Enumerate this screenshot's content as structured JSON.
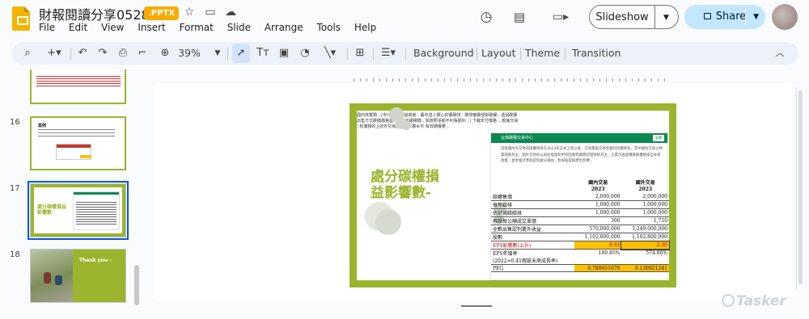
{
  "doc": {
    "title": "財報閱讀分享0528",
    "format_badge": ".PPTX"
  },
  "menu": [
    "File",
    "Edit",
    "View",
    "Insert",
    "Format",
    "Slide",
    "Arrange",
    "Tools",
    "Help"
  ],
  "header": {
    "slideshow_label": "Slideshow",
    "share_label": "Share"
  },
  "toolbar": {
    "zoom": "39%",
    "background": "Background",
    "layout": "Layout",
    "theme": "Theme",
    "transition": "Transition"
  },
  "thumbnails": [
    {
      "num": "",
      "title": ""
    },
    {
      "num": "16",
      "title": "案例"
    },
    {
      "num": "17",
      "title": "處分碳權損益影響數"
    },
    {
      "num": "18",
      "title": "Thank you~"
    }
  ],
  "slide": {
    "intro": "國內林業類...(市(市值市場過高新 ; 臺中送人類心的關碳排 ; 碳排實碳發對碳權 ; 透過碳權出售方式碳價價格基準 ; 碳出碳碳價 ; 與按照淨額不利賬額外...) 下載年付價格 ...根據交易 ; 有價額的上的外交易影部對影響水平 有效碳權量 。",
    "title": "處分碳權損\n益影響數-",
    "panel_header": "台灣碳權交易中心",
    "panel_tag": "新聞",
    "panel_text": "首批國內外交易的碳權項目在2023年正式上架以後，交易量與交易金額均持續增長，其中國內交易以林業碳匯為主，國外交易則以再生能源及甲烷回收等國際認證項目為主，企業可透過購買碳權抵換自身排放量，並依會計準則認列處分損益，對每股盈餘產生影響。",
    "table": {
      "headers": [
        "",
        "國內交易",
        "國外交易"
      ],
      "years": [
        "",
        "2023",
        "2023"
      ],
      "rows": [
        {
          "label": "碳權售價",
          "a": "2,000,000",
          "b": "2,000,000"
        },
        {
          "label": "每年碳排",
          "a": "1,000,000",
          "b": "1,000,000"
        },
        {
          "label": "估計減碳碳排",
          "a": "1,000,000",
          "b": "1,000,000"
        },
        {
          "label": "假設每公噸成交單價",
          "a": "300",
          "b": "1,710"
        },
        {
          "label": "全數出售認列業外收益",
          "a": "570,000,000",
          "b": "3,249,000,000"
        },
        {
          "label": "股數",
          "a": "1,102,800,000",
          "b": "1,102,800,000"
        },
        {
          "label": "EPS影響數(上升)",
          "a": "0.41",
          "b": "2.36"
        },
        {
          "label": "EPS年增率",
          "a": "100.85%",
          "b": "574.86%"
        },
        {
          "label": "(2022=0.41假設未來成長率)",
          "a": "",
          "b": ""
        },
        {
          "label": "PEG",
          "a": "0.780451076",
          "b": "0.136921241"
        }
      ]
    }
  },
  "watermark": "Tasker"
}
